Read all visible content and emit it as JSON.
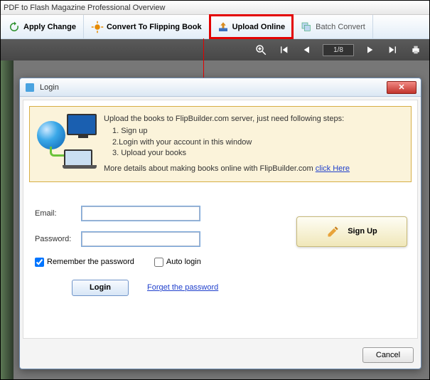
{
  "main": {
    "title": "PDF to Flash Magazine Professional Overview"
  },
  "toolbar": {
    "apply": "Apply Change",
    "convert": "Convert To Flipping Book",
    "upload": "Upload Online",
    "batch": "Batch Convert"
  },
  "viewer": {
    "page": "1/8"
  },
  "dialog": {
    "title": "Login",
    "info_intro": "Upload the books to FlipBuilder.com server, just need following steps:",
    "step1": "  1. Sign up",
    "step2": "  2.Login with your account in this window",
    "step3": "  3. Upload your books",
    "info_more": "More details about making books online with FlipBuilder.com   ",
    "click_here": "click Here",
    "email_label": "Email:",
    "password_label": "Password:",
    "remember": "Remember the password",
    "autologin": "Auto login",
    "login_btn": "Login",
    "forget": "Forget the password",
    "signup": "Sign Up",
    "cancel": "Cancel"
  }
}
